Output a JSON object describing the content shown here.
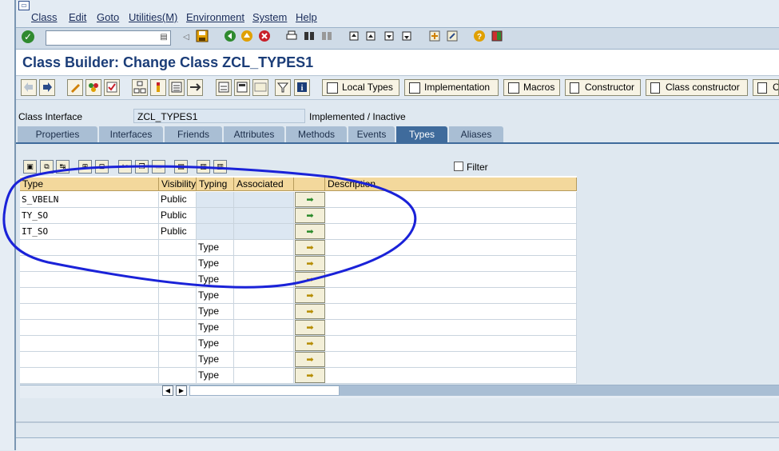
{
  "menu": {
    "items": [
      "Class",
      "Edit",
      "Goto",
      "Utilities(M)",
      "Environment",
      "System",
      "Help"
    ]
  },
  "title": "Class Builder: Change Class ZCL_TYPES1",
  "app_toolbar": {
    "local_types": "Local Types",
    "implementation": "Implementation",
    "macros": "Macros",
    "constructor": "Constructor",
    "class_constructor": "Class constructor",
    "cla": "Cla"
  },
  "header_fields": {
    "class_interface_label": "Class Interface",
    "class_interface_value": "ZCL_TYPES1",
    "status": "Implemented / Inactive"
  },
  "tabs": [
    "Properties",
    "Interfaces",
    "Friends",
    "Attributes",
    "Methods",
    "Events",
    "Types",
    "Aliases"
  ],
  "active_tab": "Types",
  "filter_label": "Filter",
  "grid": {
    "columns": [
      "Type",
      "Visibility",
      "Typing",
      "Associated",
      "",
      "Description"
    ],
    "rows": [
      {
        "type": "S_VBELN",
        "visibility": "Public",
        "typing": ""
      },
      {
        "type": "TY_SO",
        "visibility": "Public",
        "typing": ""
      },
      {
        "type": "IT_SO",
        "visibility": "Public",
        "typing": ""
      },
      {
        "type": "",
        "visibility": "",
        "typing": "Type"
      },
      {
        "type": "",
        "visibility": "",
        "typing": "Type"
      },
      {
        "type": "",
        "visibility": "",
        "typing": "Type"
      },
      {
        "type": "",
        "visibility": "",
        "typing": "Type"
      },
      {
        "type": "",
        "visibility": "",
        "typing": "Type"
      },
      {
        "type": "",
        "visibility": "",
        "typing": "Type"
      },
      {
        "type": "",
        "visibility": "",
        "typing": "Type"
      },
      {
        "type": "",
        "visibility": "",
        "typing": "Type"
      },
      {
        "type": "",
        "visibility": "",
        "typing": "Type"
      }
    ]
  },
  "colors": {
    "title": "#1b3d78",
    "tab_active": "#3f6b9c",
    "header_bg": "#f3d89c",
    "annotation": "#1a22d8"
  },
  "icons": [
    "enter-icon",
    "save-icon",
    "back-icon",
    "exit-icon",
    "cancel-icon",
    "print-icon",
    "find-icon",
    "help-icon"
  ]
}
